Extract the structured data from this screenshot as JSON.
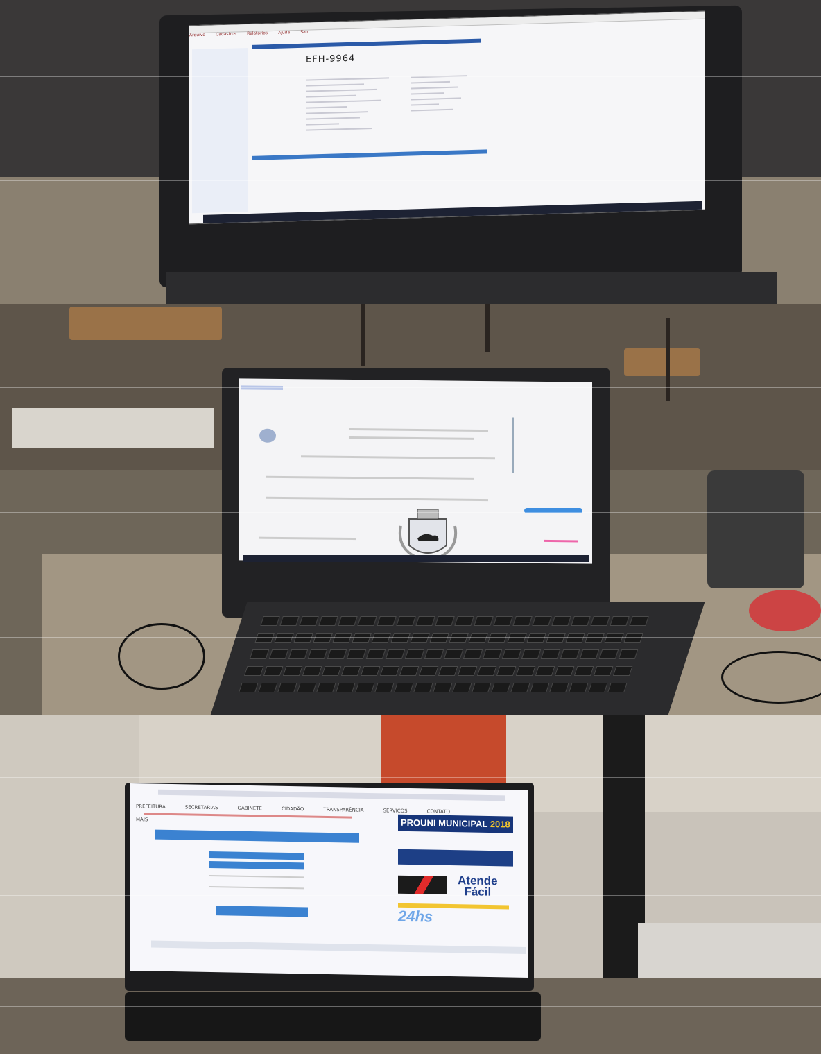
{
  "panel1": {
    "menu_items": [
      "Arquivo",
      "Cadastros",
      "Relatórios",
      "Ajuda",
      "Sair"
    ],
    "plate_text": "EFH-9964"
  },
  "panel3": {
    "nav_items": [
      "PREFEITURA",
      "SECRETARIAS",
      "GABINETE",
      "CIDADÃO",
      "TRANSPARÊNCIA",
      "SERVIÇOS",
      "CONTATO",
      "MAIS"
    ],
    "ad_prouni_prefix": "PROUNI MUNICIPAL",
    "ad_prouni_year": "2018",
    "ad_atende_line1": "Atende",
    "ad_atende_line2": "Fácil",
    "ad_24hs": "24hs"
  },
  "colors": {
    "accent_blue": "#3b82d1",
    "prouni_navy": "#17357a",
    "prouni_yellow": "#f3c62c",
    "door_red": "#c64a2c"
  }
}
